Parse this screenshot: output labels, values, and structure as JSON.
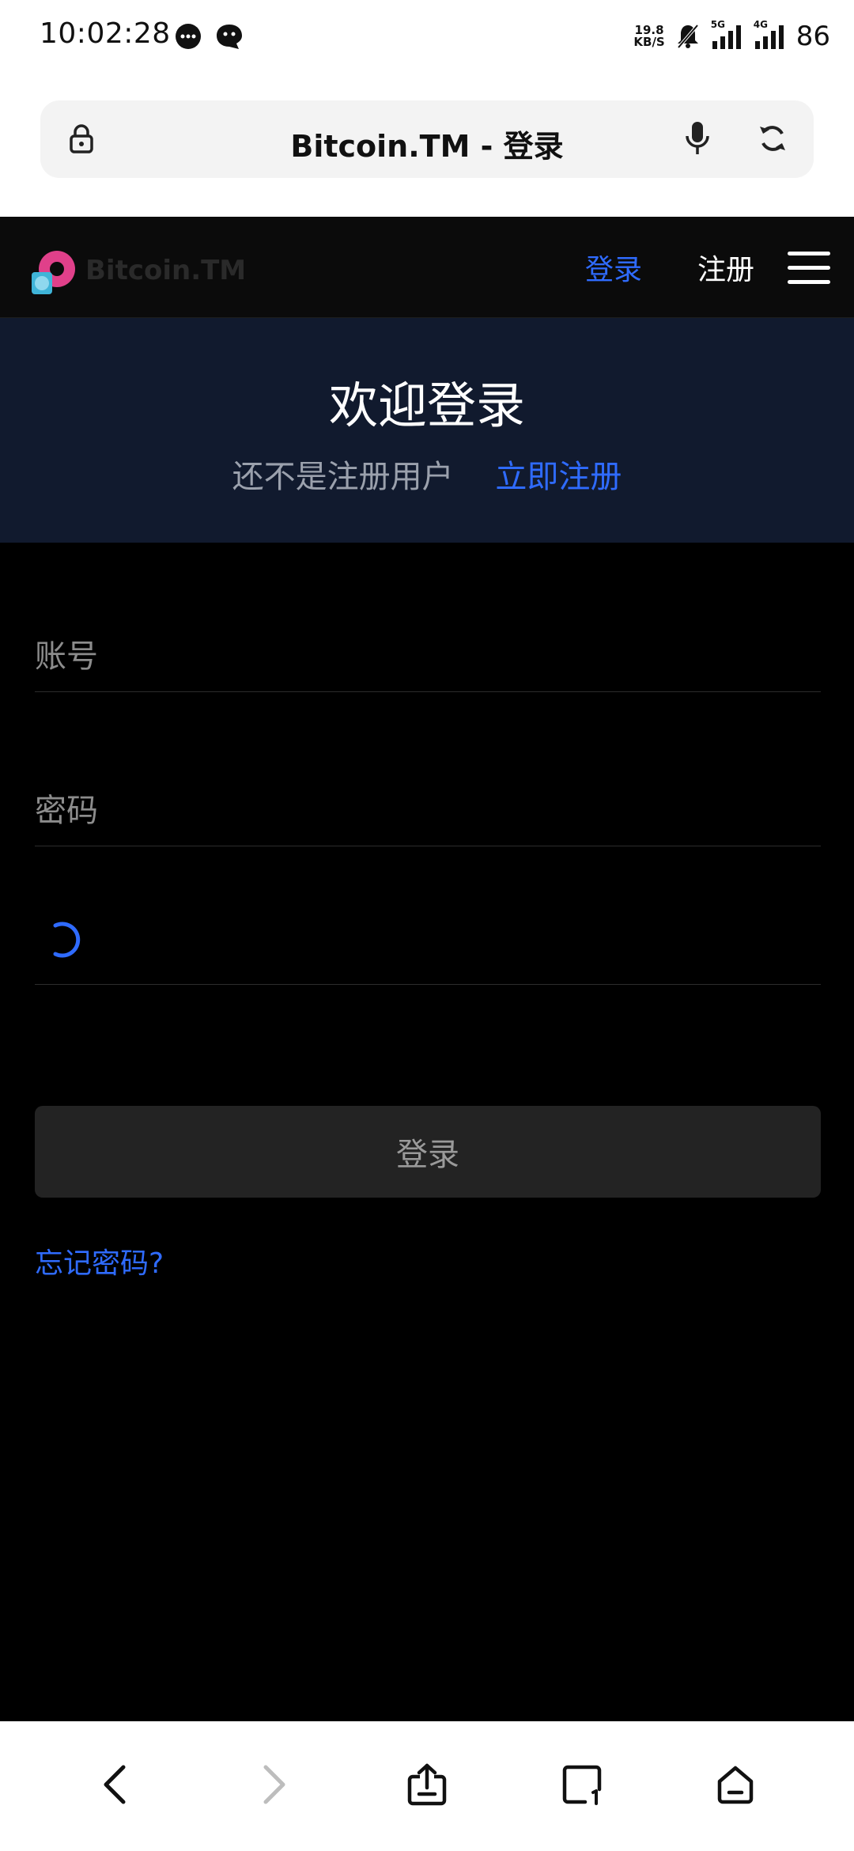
{
  "status_bar": {
    "time": "10:02:28",
    "net_speed_value": "19.8",
    "net_speed_unit": "KB/S",
    "net_5g": "5G",
    "net_4g": "4G",
    "battery": "86"
  },
  "browser": {
    "page_title": "Bitcoin.TM - 登录"
  },
  "header": {
    "logo_text": "Bitcoin.TM",
    "nav_login": "登录",
    "nav_register": "注册"
  },
  "banner": {
    "title": "欢迎登录",
    "subtitle": "还不是注册用户",
    "register_link": "立即注册"
  },
  "form": {
    "account_placeholder": "账号",
    "account_value": "",
    "password_placeholder": "密码",
    "password_value": "",
    "submit_label": "登录",
    "forgot_label": "忘记密码?"
  },
  "colors": {
    "accent": "#2f6bff",
    "banner_bg": "#111a2e",
    "page_bg": "#000000"
  }
}
